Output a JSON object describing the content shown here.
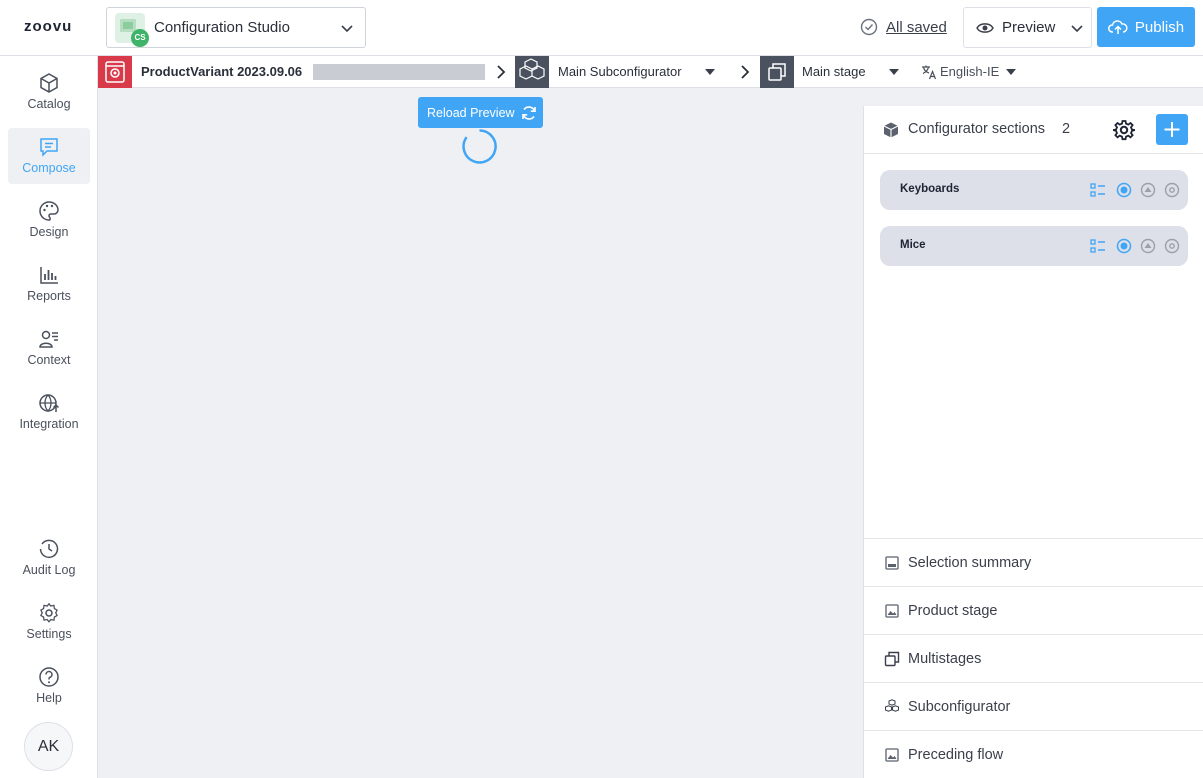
{
  "header": {
    "logo": "zoovu",
    "app_name": "Configuration Studio",
    "app_badge": "CS",
    "saved_label": "All saved",
    "preview_label": "Preview",
    "publish_label": "Publish"
  },
  "nav": {
    "items": [
      {
        "label": "Catalog",
        "icon": "cube-icon"
      },
      {
        "label": "Compose",
        "icon": "chat-icon",
        "active": true
      },
      {
        "label": "Design",
        "icon": "palette-icon"
      },
      {
        "label": "Reports",
        "icon": "bar-chart-icon"
      },
      {
        "label": "Context",
        "icon": "user-list-icon"
      },
      {
        "label": "Integration",
        "icon": "globe-icon"
      }
    ],
    "bottom_items": [
      {
        "label": "Audit Log",
        "icon": "history-icon"
      },
      {
        "label": "Settings",
        "icon": "gear-icon"
      },
      {
        "label": "Help",
        "icon": "help-icon"
      }
    ],
    "avatar_initials": "AK"
  },
  "breadcrumb": {
    "variant": "ProductVariant 2023.09.06",
    "subconfigurator": "Main Subconfigurator",
    "stage": "Main stage",
    "language": "English-IE"
  },
  "canvas": {
    "reload_label": "Reload Preview"
  },
  "panel": {
    "title": "Configurator sections",
    "count": "2",
    "sections": [
      {
        "label": "Keyboards"
      },
      {
        "label": "Mice"
      }
    ],
    "bottom_items": [
      {
        "label": "Selection summary",
        "icon": "summary-icon"
      },
      {
        "label": "Product stage",
        "icon": "image-icon"
      },
      {
        "label": "Multistages",
        "icon": "stack-icon"
      },
      {
        "label": "Subconfigurator",
        "icon": "cubes-icon"
      },
      {
        "label": "Preceding flow",
        "icon": "image-icon"
      }
    ]
  },
  "colors": {
    "accent": "#41a5f5",
    "sidebar_bg": "#ffffff",
    "canvas_bg": "#eef0f4",
    "crumb_red": "#d93a4a",
    "crumb_dark": "#4a5260"
  }
}
